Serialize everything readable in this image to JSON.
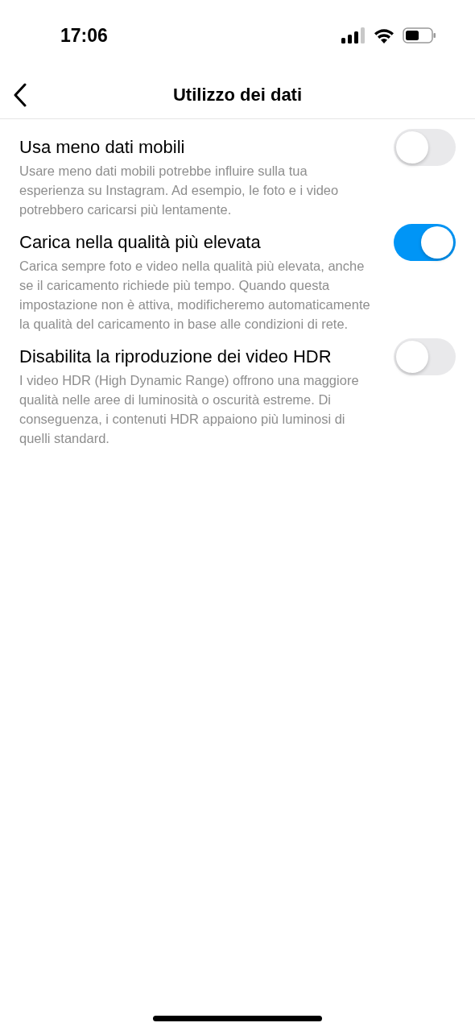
{
  "status_bar": {
    "time": "17:06"
  },
  "header": {
    "title": "Utilizzo dei dati"
  },
  "settings": [
    {
      "title": "Usa meno dati mobili",
      "description": "Usare meno dati mobili potrebbe influire sulla tua esperienza su Instagram. Ad esempio, le foto e i video potrebbero caricarsi più lentamente.",
      "on": false
    },
    {
      "title": "Carica nella qualità più elevata",
      "description": "Carica sempre foto e video nella qualità più elevata, anche se il caricamento richiede più tempo. Quando questa impostazione non è attiva, modificheremo automaticamente la qualità del caricamento in base alle condizioni di rete.",
      "on": true
    },
    {
      "title": "Disabilita la riproduzione dei video HDR",
      "description": "I video HDR (High Dynamic Range) offrono una maggiore qualità nelle aree di luminosità o oscurità estreme. Di conseguenza, i contenuti HDR appaiono più luminosi di quelli standard.",
      "on": false
    }
  ]
}
